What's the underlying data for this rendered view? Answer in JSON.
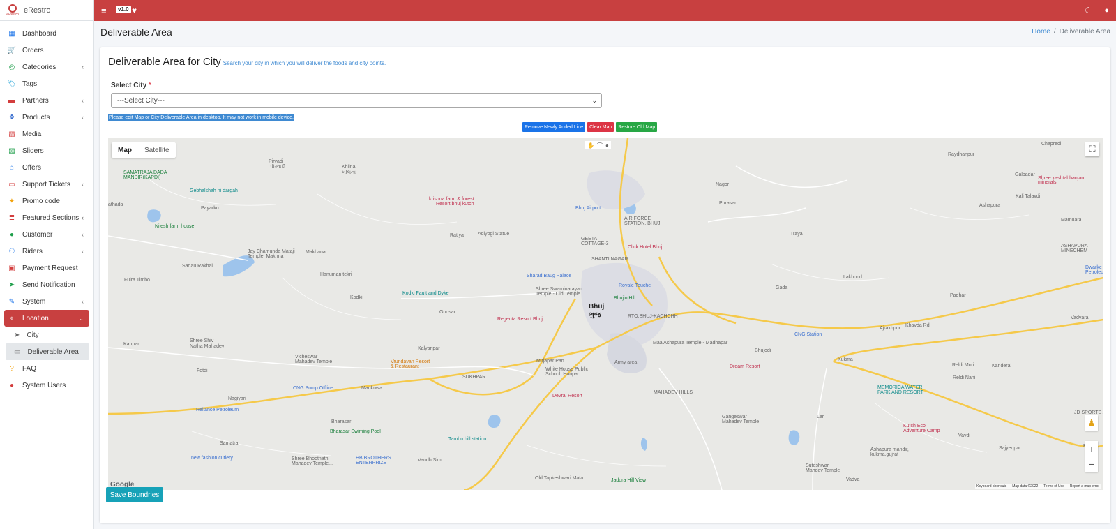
{
  "brand": {
    "name": "eRestro",
    "logo_text": "eRestro"
  },
  "topbar": {
    "version": "v1.0"
  },
  "sidebar": {
    "items": [
      {
        "label": "Dashboard",
        "icon": "dashboard-icon",
        "glyph": "▦",
        "color": "#1a73e8",
        "expandable": false
      },
      {
        "label": "Orders",
        "icon": "cart-icon",
        "glyph": "🛒",
        "color": "#f2a20c",
        "expandable": false
      },
      {
        "label": "Categories",
        "icon": "target-icon",
        "glyph": "◎",
        "color": "#1e9e4a",
        "expandable": true
      },
      {
        "label": "Tags",
        "icon": "tag-icon",
        "glyph": "🏷",
        "color": "#1a9fd6",
        "expandable": false
      },
      {
        "label": "Partners",
        "icon": "store-icon",
        "glyph": "▬",
        "color": "#d33d3d",
        "expandable": true
      },
      {
        "label": "Products",
        "icon": "cubes-icon",
        "glyph": "❖",
        "color": "#3a6fcf",
        "expandable": true
      },
      {
        "label": "Media",
        "icon": "images-icon",
        "glyph": "▧",
        "color": "#d33d3d",
        "expandable": false
      },
      {
        "label": "Sliders",
        "icon": "image-icon",
        "glyph": "▨",
        "color": "#1e9e4a",
        "expandable": false
      },
      {
        "label": "Offers",
        "icon": "gift-icon",
        "glyph": "⌂",
        "color": "#1a73e8",
        "expandable": false
      },
      {
        "label": "Support Tickets",
        "icon": "ticket-icon",
        "glyph": "▭",
        "color": "#d33d3d",
        "expandable": true
      },
      {
        "label": "Promo code",
        "icon": "puzzle-icon",
        "glyph": "✦",
        "color": "#f2a20c",
        "expandable": false
      },
      {
        "label": "Featured Sections",
        "icon": "layers-icon",
        "glyph": "≣",
        "color": "#d33d3d",
        "expandable": true
      },
      {
        "label": "Customer",
        "icon": "user-icon",
        "glyph": "●",
        "color": "#1e9e4a",
        "expandable": true
      },
      {
        "label": "Riders",
        "icon": "motorcycle-icon",
        "glyph": "⚇",
        "color": "#1a73e8",
        "expandable": true
      },
      {
        "label": "Payment Request",
        "icon": "money-icon",
        "glyph": "▣",
        "color": "#d33d3d",
        "expandable": false
      },
      {
        "label": "Send Notification",
        "icon": "paper-plane-icon",
        "glyph": "➤",
        "color": "#1e9e4a",
        "expandable": false
      },
      {
        "label": "System",
        "icon": "wrench-icon",
        "glyph": "✎",
        "color": "#1a73e8",
        "expandable": true
      }
    ],
    "location": {
      "label": "Location",
      "icon": "map-marked-icon",
      "glyph": "⌖"
    },
    "location_sub": [
      {
        "label": "City",
        "icon": "location-arrow-icon",
        "glyph": "➤"
      },
      {
        "label": "Deliverable Area",
        "icon": "map-icon",
        "glyph": "▭"
      }
    ],
    "after": [
      {
        "label": "FAQ",
        "icon": "question-circle-icon",
        "glyph": "?",
        "color": "#f2a20c"
      },
      {
        "label": "System Users",
        "icon": "user-tie-icon",
        "glyph": "●",
        "color": "#d33d3d"
      }
    ]
  },
  "page": {
    "title": "Deliverable Area",
    "breadcrumb_home": "Home",
    "breadcrumb_sep": "/",
    "breadcrumb_current": "Deliverable Area"
  },
  "card": {
    "title": "Deliverable Area for City",
    "hint": "Search your city in which you will deliver the foods and city points.",
    "select_label": "Select City",
    "required_mark": "*",
    "select_value": "---Select City---",
    "warning": "Please edit Map or City Deliverable Area in desktop. It may not work in mobile device.",
    "buttons": {
      "remove_line": "Remove Newly Added Line",
      "clear_map": "Clear Map",
      "restore_map": "Restore Old Map"
    },
    "save_button": "Save Boundries"
  },
  "map": {
    "type_map": "Map",
    "type_satellite": "Satellite",
    "logo": "Google",
    "attribution": {
      "shortcuts": "Keyboard shortcuts",
      "data": "Map data ©2022",
      "terms": "Terms of Use",
      "report": "Report a map error"
    },
    "labels": [
      {
        "text": "Pirvadi",
        "cls": ""
      },
      {
        "text": "પીરવાડી",
        "cls": ""
      },
      {
        "text": "Khilna",
        "cls": ""
      },
      {
        "text": "ખીલના",
        "cls": ""
      },
      {
        "text": "SAMATRAJA DADA",
        "cls": "poi-green"
      },
      {
        "text": "MANDIR(KAPDI)",
        "cls": "poi-green"
      },
      {
        "text": "Gebhalshah ni dargah",
        "cls": "poi-teal"
      },
      {
        "text": "krishna farm & forest",
        "cls": "poi-pink"
      },
      {
        "text": "Resort bhuj kutch",
        "cls": "poi-pink"
      },
      {
        "text": "athada",
        "cls": ""
      },
      {
        "text": "Payarko",
        "cls": ""
      },
      {
        "text": "Nilesh farm house",
        "cls": "poi-green"
      },
      {
        "text": "Ratiya",
        "cls": ""
      },
      {
        "text": "Adiyogi Statue",
        "cls": ""
      },
      {
        "text": "Bhuj Airport",
        "cls": "poi-blue"
      },
      {
        "text": "AIR FORCE",
        "cls": ""
      },
      {
        "text": "STATION, BHUJ",
        "cls": ""
      },
      {
        "text": "GEETA",
        "cls": ""
      },
      {
        "text": "COTTAGE-3",
        "cls": ""
      },
      {
        "text": "Click Hotel Bhuj",
        "cls": "poi-pink"
      },
      {
        "text": "Jay Chamunda Mataji",
        "cls": ""
      },
      {
        "text": "Temple, Makhna",
        "cls": ""
      },
      {
        "text": "Makhana",
        "cls": ""
      },
      {
        "text": "SHANTI NAGAR",
        "cls": ""
      },
      {
        "text": "Sadau Rakhal",
        "cls": ""
      },
      {
        "text": "Hanuman tekri",
        "cls": ""
      },
      {
        "text": "Sharad Baug Palace",
        "cls": "poi-blue"
      },
      {
        "text": "Fulra Timbo",
        "cls": ""
      },
      {
        "text": "Royale Touche",
        "cls": "poi-blue"
      },
      {
        "text": "Kodki Fault and Dyke",
        "cls": "poi-teal"
      },
      {
        "text": "Shree Swaminarayan",
        "cls": ""
      },
      {
        "text": "Temple - Old Temple",
        "cls": ""
      },
      {
        "text": "Kodki",
        "cls": ""
      },
      {
        "text": "Bhujio Hill",
        "cls": "poi-green"
      },
      {
        "text": "Godsar",
        "cls": ""
      },
      {
        "text": "Bhuj",
        "cls": "city"
      },
      {
        "text": "ભુજ",
        "cls": "city"
      },
      {
        "text": "RTO,BHUJ-KACHCHH",
        "cls": ""
      },
      {
        "text": "Regenta Resort Bhuj",
        "cls": "poi-pink"
      },
      {
        "text": "Maa Ashapura Temple - Madhapar",
        "cls": ""
      },
      {
        "text": "Kanpar",
        "cls": ""
      },
      {
        "text": "Shree Shiv",
        "cls": ""
      },
      {
        "text": "Natha Mahadev",
        "cls": ""
      },
      {
        "text": "Kalyanpar",
        "cls": ""
      },
      {
        "text": "Mirjapar Part",
        "cls": ""
      },
      {
        "text": "Army area",
        "cls": ""
      },
      {
        "text": "Vicheswar",
        "cls": ""
      },
      {
        "text": "Mahadev Temple",
        "cls": ""
      },
      {
        "text": "Vrundavan Resort",
        "cls": "poi-orange"
      },
      {
        "text": "& Restaurant",
        "cls": "poi-orange"
      },
      {
        "text": "SUKHPAR",
        "cls": ""
      },
      {
        "text": "White House Public",
        "cls": ""
      },
      {
        "text": "School, Haripar",
        "cls": ""
      },
      {
        "text": "Fotdi",
        "cls": ""
      },
      {
        "text": "CNG Pump Offline",
        "cls": "poi-blue"
      },
      {
        "text": "Mankuwa",
        "cls": ""
      },
      {
        "text": "MAHADEV HILLS",
        "cls": ""
      },
      {
        "text": "Devraj Resort",
        "cls": "poi-pink"
      },
      {
        "text": "Nagiyari",
        "cls": ""
      },
      {
        "text": "Reliance Petroleum",
        "cls": "poi-blue"
      },
      {
        "text": "Bharasar",
        "cls": ""
      },
      {
        "text": "Bharasar Swiming Pool",
        "cls": "poi-green"
      },
      {
        "text": "Tambu hill station",
        "cls": "poi-teal"
      },
      {
        "text": "Samatra",
        "cls": ""
      },
      {
        "text": "new fashion cutlery",
        "cls": "poi-blue"
      },
      {
        "text": "HB BROTHERS",
        "cls": "poi-blue"
      },
      {
        "text": "ENTERPRIZE",
        "cls": "poi-blue"
      },
      {
        "text": "Shree Bhootnath",
        "cls": ""
      },
      {
        "text": "Mahadev Temple...",
        "cls": ""
      },
      {
        "text": "Vandh Sim",
        "cls": ""
      },
      {
        "text": "Old Tapkeshwari Mata",
        "cls": ""
      },
      {
        "text": "Jadura Hill View",
        "cls": "poi-green"
      },
      {
        "text": "Raydhanpur",
        "cls": ""
      },
      {
        "text": "Chapredi",
        "cls": ""
      },
      {
        "text": "Galpadar",
        "cls": ""
      },
      {
        "text": "Nagor",
        "cls": ""
      },
      {
        "text": "Purasar",
        "cls": ""
      },
      {
        "text": "Ashapura",
        "cls": ""
      },
      {
        "text": "Kali Talavdi",
        "cls": ""
      },
      {
        "text": "Shree kashtabhanjan",
        "cls": "poi-pink"
      },
      {
        "text": "minerals",
        "cls": "poi-pink"
      },
      {
        "text": "Traya",
        "cls": ""
      },
      {
        "text": "Mamuara",
        "cls": ""
      },
      {
        "text": "ASHAPURA",
        "cls": ""
      },
      {
        "text": "MINECHEM",
        "cls": ""
      },
      {
        "text": "Lakhond",
        "cls": ""
      },
      {
        "text": "Dwarke",
        "cls": "poi-blue"
      },
      {
        "text": "Petroleum C",
        "cls": "poi-blue"
      },
      {
        "text": "Gada",
        "cls": ""
      },
      {
        "text": "Padhar",
        "cls": ""
      },
      {
        "text": "Vadvara",
        "cls": ""
      },
      {
        "text": "CNG Station",
        "cls": "poi-blue"
      },
      {
        "text": "Ajrakhpur",
        "cls": ""
      },
      {
        "text": "Khavda Rd",
        "cls": ""
      },
      {
        "text": "Bhujodi",
        "cls": ""
      },
      {
        "text": "Dream Resort",
        "cls": "poi-pink"
      },
      {
        "text": "Kukma",
        "cls": ""
      },
      {
        "text": "Reldi Moti",
        "cls": ""
      },
      {
        "text": "Kanderai",
        "cls": ""
      },
      {
        "text": "Reldi Nani",
        "cls": ""
      },
      {
        "text": "MEMORICA WATER",
        "cls": "poi-teal"
      },
      {
        "text": "PARK AND RESORT",
        "cls": "poi-teal"
      },
      {
        "text": "JD SPORTS ACADEMY",
        "cls": ""
      },
      {
        "text": "Gangeswar",
        "cls": ""
      },
      {
        "text": "Mahadev Temple",
        "cls": ""
      },
      {
        "text": "Ler",
        "cls": ""
      },
      {
        "text": "Kutch Eco",
        "cls": "poi-pink"
      },
      {
        "text": "Adventure Camp",
        "cls": "poi-pink"
      },
      {
        "text": "Vavdi",
        "cls": ""
      },
      {
        "text": "Ashapura mandir,",
        "cls": ""
      },
      {
        "text": "kukma,gujrat",
        "cls": ""
      },
      {
        "text": "Sajyedpar",
        "cls": ""
      },
      {
        "text": "Suteshwar",
        "cls": ""
      },
      {
        "text": "Mahdev Temple",
        "cls": ""
      },
      {
        "text": "Vadva",
        "cls": ""
      },
      {
        "text": "Bhara",
        "cls": ""
      }
    ]
  }
}
